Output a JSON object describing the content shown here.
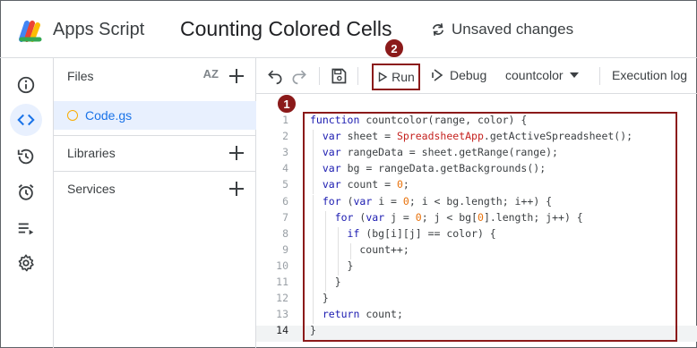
{
  "header": {
    "app_name": "Apps Script",
    "project_title": "Counting Colored Cells",
    "save_status": "Unsaved changes"
  },
  "rail": {
    "items": [
      "overview-icon",
      "editor-icon",
      "triggers-history-icon",
      "triggers-icon",
      "executions-icon",
      "settings-icon"
    ]
  },
  "files_panel": {
    "files_label": "Files",
    "sort_label": "AZ",
    "file_name": "Code.gs",
    "libraries_label": "Libraries",
    "services_label": "Services"
  },
  "toolbar": {
    "run_label": "Run",
    "debug_label": "Debug",
    "function_name": "countcolor",
    "execution_log_label": "Execution log"
  },
  "editor": {
    "line_numbers": [
      "1",
      "2",
      "3",
      "4",
      "5",
      "6",
      "7",
      "8",
      "9",
      "10",
      "11",
      "12",
      "13",
      "14"
    ],
    "current_line": 14,
    "lines": [
      "function countcolor(range, color) {",
      "  var sheet = SpreadsheetApp.getActiveSpreadsheet();",
      "  var rangeData = sheet.getRange(range);",
      "  var bg = rangeData.getBackgrounds();",
      "  var count = 0;",
      "  for (var i = 0; i < bg.length; i++) {",
      "    for (var j = 0; j < bg[0].length; j++) {",
      "      if (bg[i][j] == color) {",
      "        count++;",
      "      }",
      "    }",
      "  }",
      "  return count;",
      "}"
    ]
  },
  "callouts": {
    "code_badge": "1",
    "run_badge": "2"
  },
  "colors": {
    "callout": "#8b1a1a",
    "accent": "#1a73e8",
    "keyword": "#1a1ab0",
    "class_name": "#c5221f",
    "number": "#e8710a"
  }
}
